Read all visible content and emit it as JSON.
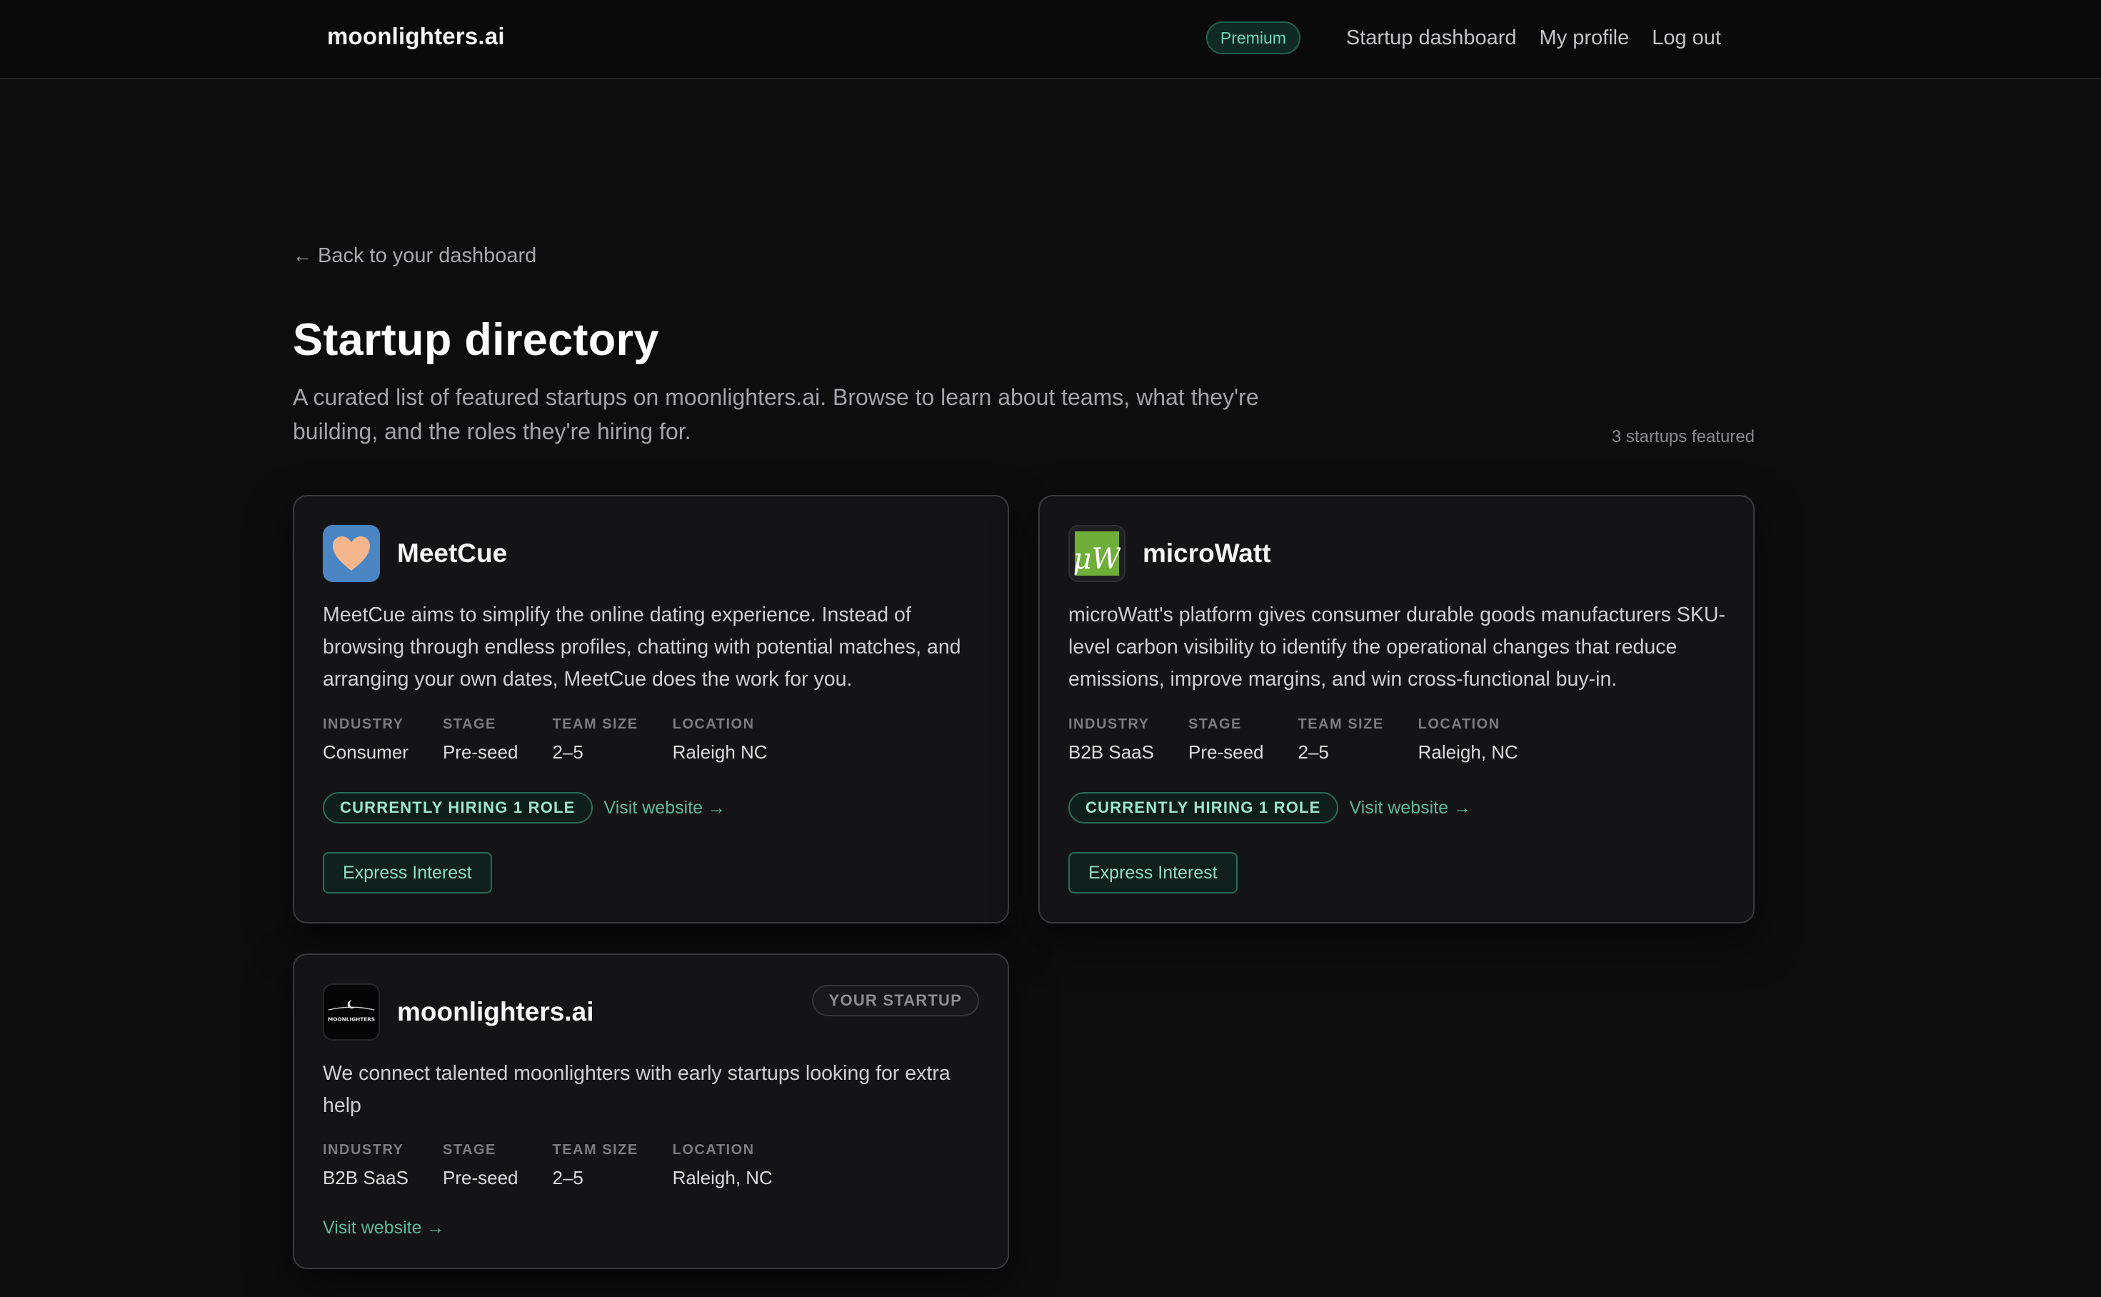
{
  "header": {
    "brand": "moonlighters.ai",
    "badge": "Premium",
    "links": [
      "Startup dashboard",
      "My profile",
      "Log out"
    ]
  },
  "page": {
    "back_label": "Back to your dashboard",
    "title": "Startup directory",
    "intro": "A curated list of featured startups on moonlighters.ai. Browse to learn about teams, what they're building, and the roles they're hiring for.",
    "count": "3 startups featured"
  },
  "meta_labels": {
    "industry": "INDUSTRY",
    "stage": "STAGE",
    "team_size": "TEAM SIZE",
    "location": "LOCATION"
  },
  "startups": [
    {
      "name": "MeetCue",
      "logo_icon": "heart-logo-icon",
      "description": "MeetCue aims to simplify the online dating experience. Instead of browsing through endless profiles, chatting with potential matches, and arranging your own dates, MeetCue does the work for you.",
      "industry": "Consumer",
      "stage": "Pre-seed",
      "team_size": "2–5",
      "location": "Raleigh NC",
      "hiring": "CURRENTLY HIRING 1 ROLE",
      "visit": "Visit website →",
      "cta": "Express Interest"
    },
    {
      "name": "microWatt",
      "logo_icon": "microwatt-logo-icon",
      "logo_text": "μW",
      "description": "microWatt's platform gives consumer durable goods manufacturers SKU-level carbon visibility to identify the operational changes that reduce emissions, improve margins, and win cross-functional buy-in.",
      "industry": "B2B SaaS",
      "stage": "Pre-seed",
      "team_size": "2–5",
      "location": "Raleigh, NC",
      "hiring": "CURRENTLY HIRING 1 ROLE",
      "visit": "Visit website →",
      "cta": "Express Interest"
    },
    {
      "name": "moonlighters.ai",
      "logo_icon": "moonlighters-logo-icon",
      "logo_text": "MOONLIGHTERS",
      "badge": "YOUR STARTUP",
      "description": "We connect talented moonlighters with early startups looking for extra help",
      "industry": "B2B SaaS",
      "stage": "Pre-seed",
      "team_size": "2–5",
      "location": "Raleigh, NC",
      "visit": "Visit website →"
    }
  ],
  "colors": {
    "background": "#0d0d0e",
    "card": "#141416",
    "accent": "#5fb79c",
    "meetcue_logo": "#4a86c3",
    "microwatt_logo": "#6fae3a"
  }
}
